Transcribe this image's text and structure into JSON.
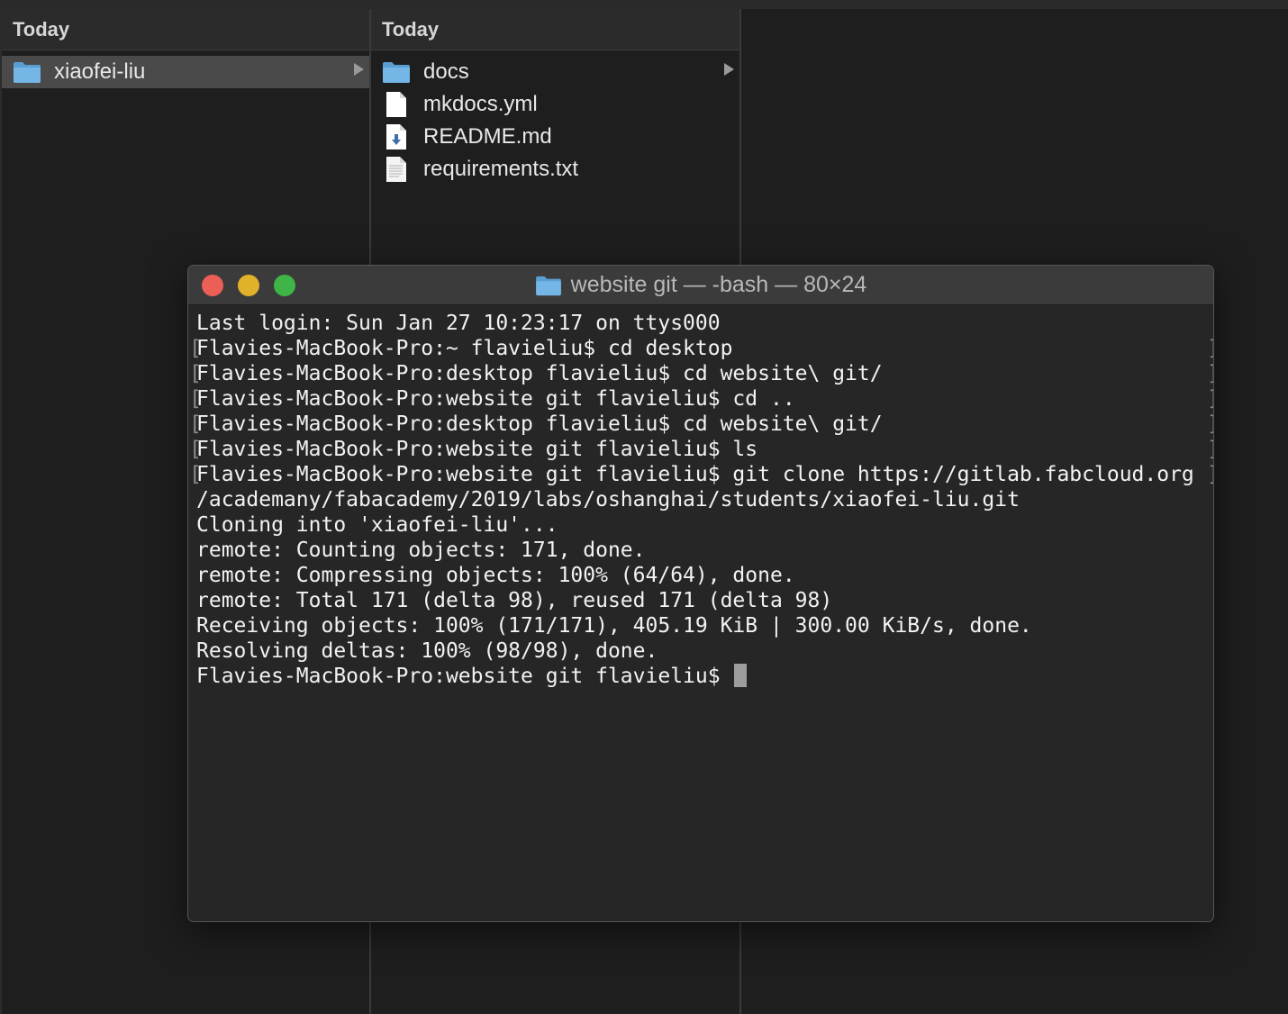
{
  "finder": {
    "column1": {
      "header": "Today",
      "items": [
        {
          "name": "xiaofei-liu",
          "icon": "folder-icon",
          "selected": true,
          "has_children": true
        }
      ]
    },
    "column2": {
      "header": "Today",
      "items": [
        {
          "name": "docs",
          "icon": "folder-icon",
          "has_children": true
        },
        {
          "name": "mkdocs.yml",
          "icon": "document-icon"
        },
        {
          "name": "README.md",
          "icon": "markdown-file-icon"
        },
        {
          "name": "requirements.txt",
          "icon": "text-file-icon"
        }
      ]
    }
  },
  "terminal": {
    "title": "website git — -bash — 80×24",
    "lines": [
      "Last login: Sun Jan 27 10:23:17 on ttys000",
      "Flavies-MacBook-Pro:~ flavieliu$ cd desktop",
      "Flavies-MacBook-Pro:desktop flavieliu$ cd website\\ git/",
      "Flavies-MacBook-Pro:website git flavieliu$ cd ..",
      "Flavies-MacBook-Pro:desktop flavieliu$ cd website\\ git/",
      "Flavies-MacBook-Pro:website git flavieliu$ ls",
      "Flavies-MacBook-Pro:website git flavieliu$ git clone https://gitlab.fabcloud.org",
      "/academany/fabacademy/2019/labs/oshanghai/students/xiaofei-liu.git",
      "Cloning into 'xiaofei-liu'...",
      "remote: Counting objects: 171, done.",
      "remote: Compressing objects: 100% (64/64), done.",
      "remote: Total 171 (delta 98), reused 171 (delta 98)",
      "Receiving objects: 100% (171/171), 405.19 KiB | 300.00 KiB/s, done.",
      "Resolving deltas: 100% (98/98), done.",
      "Flavies-MacBook-Pro:website git flavieliu$ "
    ]
  },
  "colors": {
    "close": "#ec5f57",
    "minimize": "#e1b12c",
    "maximize": "#3fb447",
    "folder": "#74b6e6",
    "selection": "#4a4a4a"
  }
}
